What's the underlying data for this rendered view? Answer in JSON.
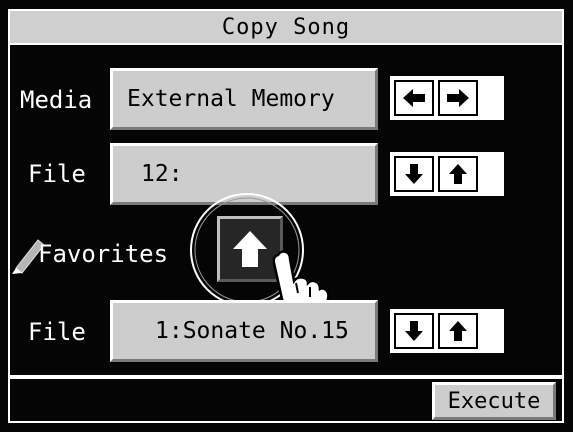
{
  "title": "Copy Song",
  "media": {
    "label": "Media",
    "value": "External Memory",
    "arrows": [
      "left-arrow-icon",
      "right-arrow-icon"
    ]
  },
  "file1": {
    "label": "File",
    "value": "12:",
    "arrows": [
      "down-arrow-icon",
      "up-arrow-icon"
    ]
  },
  "favorites": {
    "label": "Favorites",
    "icon": "pencil-icon",
    "button_icon": "up-arrow-icon"
  },
  "file2": {
    "label": "File",
    "value": "1:Sonate No.15",
    "arrows": [
      "down-arrow-icon",
      "up-arrow-icon"
    ]
  },
  "execute_label": "Execute",
  "colors": {
    "background": "#050505",
    "button": "#cdcdcd",
    "title": "#cfcfcf",
    "text": "#ffffff"
  }
}
